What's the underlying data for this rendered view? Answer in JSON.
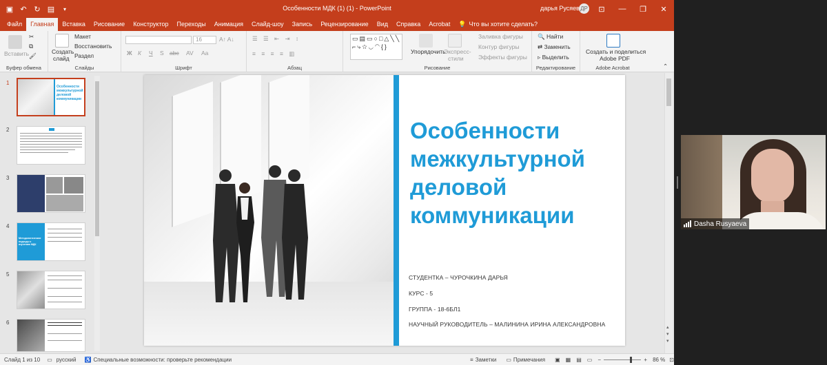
{
  "app": {
    "title": "Особенности МДК (1) (1)  -  PowerPoint",
    "user": "дарья Русяева",
    "avatar_initials": "ДР"
  },
  "qa_icons": [
    "save-icon",
    "undo-icon",
    "redo-icon",
    "present-icon",
    "more-icon"
  ],
  "tabs": [
    "Файл",
    "Главная",
    "Вставка",
    "Рисование",
    "Конструктор",
    "Переходы",
    "Анимация",
    "Слайд-шоу",
    "Запись",
    "Рецензирование",
    "Вид",
    "Справка",
    "Acrobat"
  ],
  "active_tab": "Главная",
  "tell_me": "Что вы хотите сделать?",
  "ribbon": {
    "clipboard": {
      "paste": "Вставить",
      "cut": "Вырезать",
      "label": "Буфер обмена"
    },
    "slides": {
      "new_slide": "Создать",
      "new_slide2": "слайд",
      "layout": "Макет",
      "reset": "Восстановить",
      "section": "Раздел",
      "label": "Слайды"
    },
    "font": {
      "size": "16",
      "buttons": [
        "Ж",
        "К",
        "Ч",
        "S",
        "abc",
        "AV",
        "Aa"
      ],
      "label": "Шрифт"
    },
    "paragraph": {
      "label": "Абзац"
    },
    "drawing": {
      "arrange": "Упорядочить",
      "styles": "Экспресс-",
      "styles2": "стили",
      "fill": "Заливка фигуры",
      "outline": "Контур фигуры",
      "effects": "Эффекты фигуры",
      "label": "Рисование"
    },
    "editing": {
      "find": "Найти",
      "replace": "Заменить",
      "select": "Выделить",
      "label": "Редактирование"
    },
    "acrobat": {
      "share": "Создать и поделиться",
      "share2": "Adobe PDF",
      "label": "Adobe Acrobat"
    }
  },
  "thumbnails": [
    {
      "num": "1",
      "title": "Особенности межкультурной деловой коммуникации"
    },
    {
      "num": "2"
    },
    {
      "num": "3"
    },
    {
      "num": "4",
      "title": "Методологические подходы к изучению МДК"
    },
    {
      "num": "5"
    },
    {
      "num": "6"
    }
  ],
  "slide": {
    "title": "Особенности межкультурной деловой коммуникации",
    "lines": [
      "СТУДЕНТКА – ЧУРОЧКИНА ДАРЬЯ",
      "КУРС - 5",
      "ГРУППА - 18-6БЛ1",
      "НАУЧНЫЙ РУКОВОДИТЕЛЬ – МАЛИНИНА ИРИНА АЛЕКСАНДРОВНА"
    ]
  },
  "status": {
    "slide_of": "Слайд 1 из 10",
    "language": "русский",
    "accessibility": "Специальные возможности: проверьте рекомендации",
    "notes": "Заметки",
    "comments": "Примечания",
    "zoom": "86 %"
  },
  "video": {
    "name": "Dasha Rusyaeva"
  },
  "colors": {
    "accent": "#c43e1c",
    "slide_blue": "#1f9bd7"
  }
}
